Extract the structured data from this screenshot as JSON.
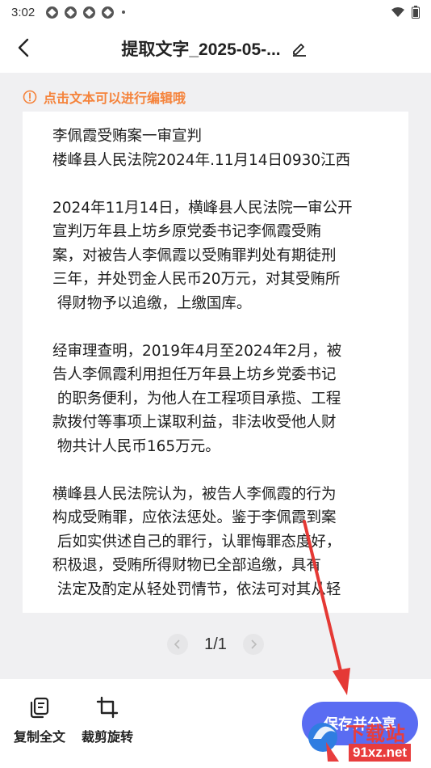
{
  "status_bar": {
    "time": "3:02"
  },
  "header": {
    "title": "提取文字_2025-05-..."
  },
  "hint": {
    "text": "点击文本可以进行编辑哦"
  },
  "document": {
    "lines": "李佩霞受贿案一审宣判\n楼峰县人民法院2024年.11月14日0930江西\n\n2024年11月14日，横峰县人民法院一审公开\n宣判万年县上坊乡原党委书记李佩霞受贿\n案，对被告人李佩霞以受贿罪判处有期徒刑\n三年，并处罚金人民币20万元，对其受贿所\n 得财物予以追缴，上缴国库。\n\n经审理查明，2019年4月至2024年2月，被\n告人李佩霞利用担任万年县上坊乡党委书记\n 的职务便利，为他人在工程项目承揽、工程\n款拨付等事项上谋取利益，非法收受他人财\n 物共计人民币165万元。\n\n横峰县人民法院认为，被告人李佩霞的行为\n构成受贿罪，应依法惩处。鉴于李佩霞到案\n 后如实供述自己的罪行，认罪悔罪态度好，\n积极退，受贿所得财物已全部追缴，具有\n 法定及酌定从轻处罚情节，依法可对其从轻"
  },
  "pager": {
    "label": "1/1",
    "current": 1,
    "total": 1
  },
  "toolbar": {
    "copy_label": "复制全文",
    "crop_label": "裁剪旋转",
    "save_label": "保存并分享"
  },
  "watermark": {
    "brand": "下载站",
    "url": "91xz.net"
  },
  "colors": {
    "accent": "#5a6cf2",
    "hint": "#f5833b",
    "annotation_arrow": "#e53935"
  },
  "icons": {
    "back": "chevron-left-icon",
    "edit": "pencil-icon",
    "hint": "warning-circle-icon",
    "copy": "copy-icon",
    "crop": "crop-rotate-icon"
  }
}
